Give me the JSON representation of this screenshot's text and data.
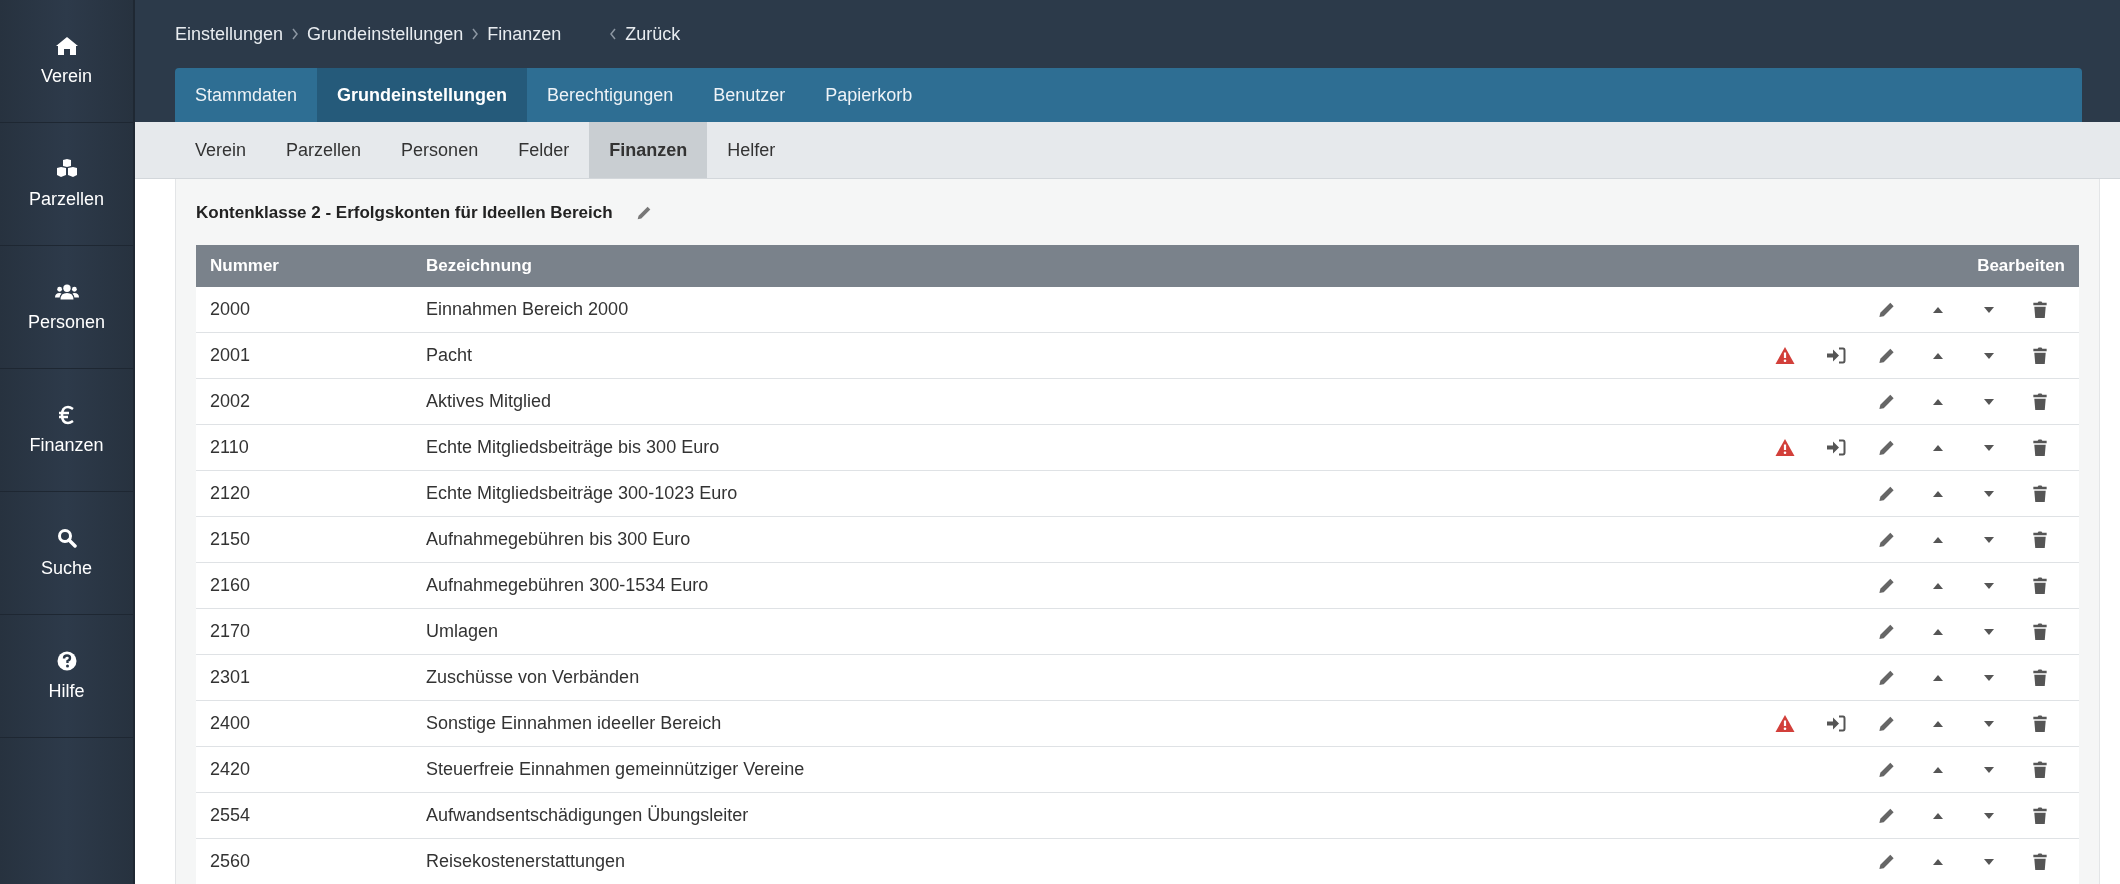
{
  "sidebar": {
    "items": [
      {
        "label": "Verein"
      },
      {
        "label": "Parzellen"
      },
      {
        "label": "Personen"
      },
      {
        "label": "Finanzen"
      },
      {
        "label": "Suche"
      },
      {
        "label": "Hilfe"
      }
    ]
  },
  "breadcrumb": [
    "Einstellungen",
    "Grundeinstellungen",
    "Finanzen"
  ],
  "back_link": "Zurück",
  "tabs": [
    {
      "label": "Stammdaten",
      "selected": false
    },
    {
      "label": "Grundeinstellungen",
      "selected": true
    },
    {
      "label": "Berechtigungen",
      "selected": false
    },
    {
      "label": "Benutzer",
      "selected": false
    },
    {
      "label": "Papierkorb",
      "selected": false
    }
  ],
  "subtabs": [
    {
      "label": "Verein",
      "selected": false
    },
    {
      "label": "Parzellen",
      "selected": false
    },
    {
      "label": "Personen",
      "selected": false
    },
    {
      "label": "Felder",
      "selected": false
    },
    {
      "label": "Finanzen",
      "selected": true
    },
    {
      "label": "Helfer",
      "selected": false
    }
  ],
  "section_title": "Kontenklasse 2 - Erfolgskonten für Ideellen Bereich",
  "table": {
    "columns": [
      "Nummer",
      "Bezeichnung",
      "Bearbeiten"
    ],
    "rows": [
      {
        "number": "2000",
        "name": "Einnahmen Bereich 2000",
        "warning": false,
        "transfer": false
      },
      {
        "number": "2001",
        "name": "Pacht",
        "warning": true,
        "transfer": true
      },
      {
        "number": "2002",
        "name": "Aktives Mitglied",
        "warning": false,
        "transfer": false
      },
      {
        "number": "2110",
        "name": "Echte Mitgliedsbeiträge bis 300 Euro",
        "warning": true,
        "transfer": true
      },
      {
        "number": "2120",
        "name": "Echte Mitgliedsbeiträge 300-1023 Euro",
        "warning": false,
        "transfer": false
      },
      {
        "number": "2150",
        "name": "Aufnahmegebühren bis 300 Euro",
        "warning": false,
        "transfer": false
      },
      {
        "number": "2160",
        "name": "Aufnahmegebühren 300-1534 Euro",
        "warning": false,
        "transfer": false
      },
      {
        "number": "2170",
        "name": "Umlagen",
        "warning": false,
        "transfer": false
      },
      {
        "number": "2301",
        "name": "Zuschüsse von Verbänden",
        "warning": false,
        "transfer": false
      },
      {
        "number": "2400",
        "name": "Sonstige Einnahmen ideeller Bereich",
        "warning": true,
        "transfer": true
      },
      {
        "number": "2420",
        "name": "Steuerfreie Einnahmen gemeinnütziger Vereine",
        "warning": false,
        "transfer": false
      },
      {
        "number": "2554",
        "name": "Aufwandsentschädigungen Übungsleiter",
        "warning": false,
        "transfer": false
      },
      {
        "number": "2560",
        "name": "Reisekostenerstattungen",
        "warning": false,
        "transfer": false
      }
    ]
  }
}
